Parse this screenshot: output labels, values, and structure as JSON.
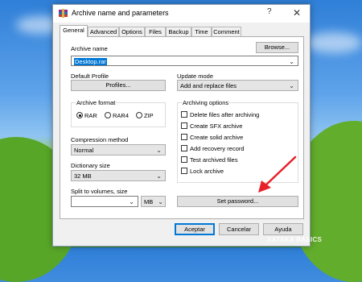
{
  "window": {
    "title": "Archive name and parameters",
    "help_label": "?",
    "close_label": "✕"
  },
  "tabs": [
    "General",
    "Advanced",
    "Options",
    "Files",
    "Backup",
    "Time",
    "Comment"
  ],
  "archive_name": {
    "label": "Archive name",
    "value": "Desktop.rar",
    "browse_label": "Browse..."
  },
  "default_profile": {
    "label": "Default Profile",
    "button_label": "Profiles..."
  },
  "update_mode": {
    "label": "Update mode",
    "value": "Add and replace files"
  },
  "archive_format": {
    "label": "Archive format",
    "options": [
      "RAR",
      "RAR4",
      "ZIP"
    ],
    "selected": "RAR"
  },
  "archiving_options": {
    "label": "Archiving options",
    "items": [
      "Delete files after archiving",
      "Create SFX archive",
      "Create solid archive",
      "Add recovery record",
      "Test archived files",
      "Lock archive"
    ]
  },
  "compression_method": {
    "label": "Compression method",
    "value": "Normal"
  },
  "dictionary_size": {
    "label": "Dictionary size",
    "value": "32 MB"
  },
  "split_volumes": {
    "label": "Split to volumes, size",
    "value": "",
    "unit": "MB"
  },
  "set_password_label": "Set password...",
  "footer": {
    "ok_label": "Aceptar",
    "cancel_label": "Cancelar",
    "help_label": "Ayuda"
  },
  "watermark": "XATAKA BASICS",
  "colors": {
    "accent": "#0078d7",
    "arrow": "#e8202a"
  }
}
